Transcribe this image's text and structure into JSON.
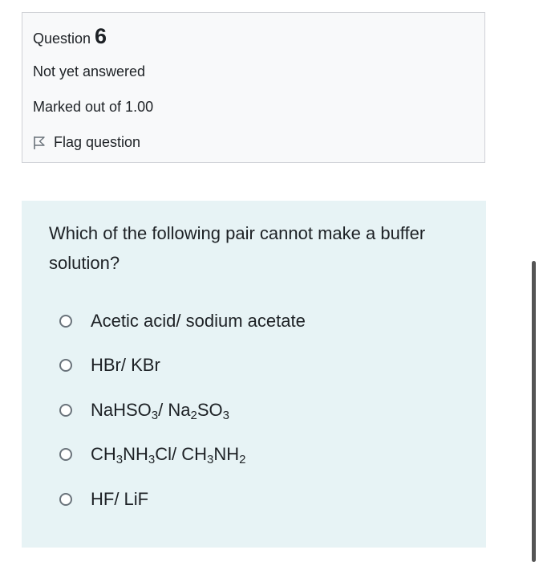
{
  "question_info": {
    "label": "Question",
    "number": "6",
    "state": "Not yet answered",
    "grade": "Marked out of 1.00",
    "flag_label": "Flag question"
  },
  "question": {
    "text": "Which of the following pair cannot make a buffer solution?",
    "answers": [
      {
        "label": "Acetic acid/ sodium acetate",
        "selected": false
      },
      {
        "label": "HBr/ KBr",
        "selected": false
      },
      {
        "label": "NaHSO3/ Na2SO3",
        "selected": false
      },
      {
        "label": "CH3NH3Cl/ CH3NH2",
        "selected": false
      },
      {
        "label": "HF/ LiF",
        "selected": false
      }
    ]
  },
  "colors": {
    "info_background": "#f8f9fa",
    "content_background": "#e7f3f5",
    "text": "#1d2125"
  }
}
